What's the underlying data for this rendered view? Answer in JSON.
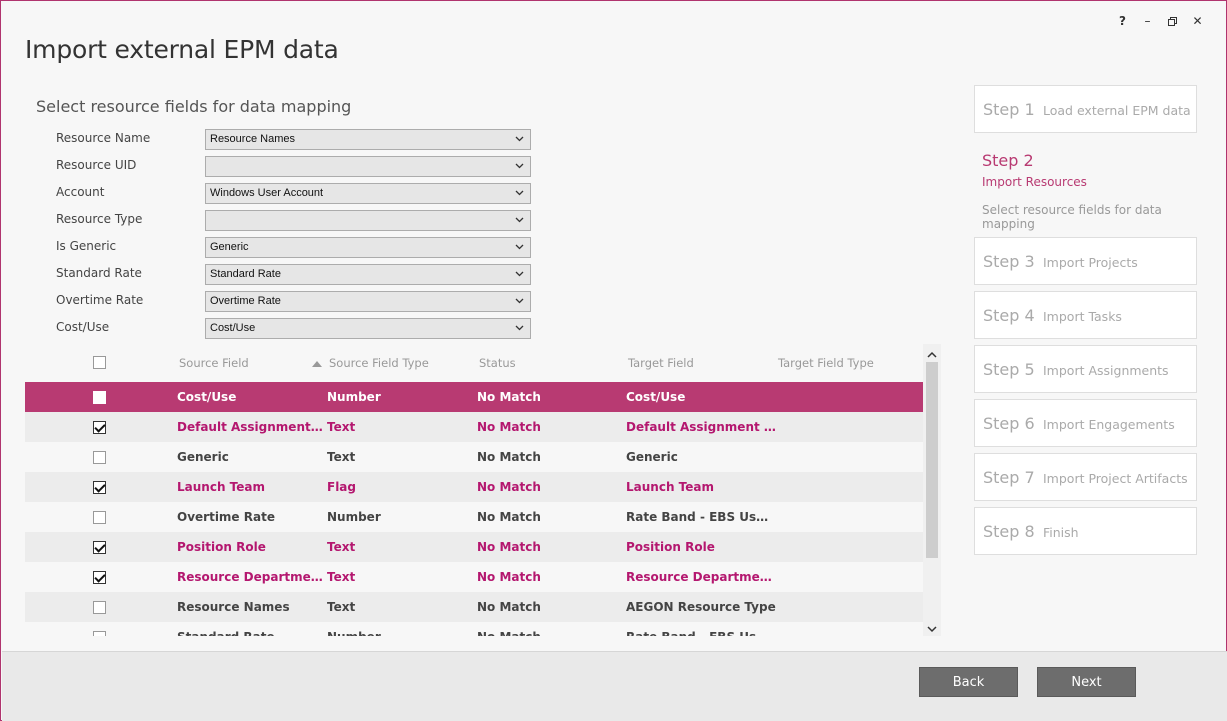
{
  "window": {
    "title": "Import external EPM data",
    "controls": {
      "help": "?",
      "minimize": "–",
      "restore": "🗗",
      "close": "✕"
    }
  },
  "section": {
    "title": "Select resource fields for data mapping"
  },
  "form": {
    "fields": [
      {
        "label": "Resource Name",
        "value": "Resource Names"
      },
      {
        "label": "Resource UID",
        "value": ""
      },
      {
        "label": "Account",
        "value": "Windows User Account"
      },
      {
        "label": "Resource Type",
        "value": ""
      },
      {
        "label": "Is Generic",
        "value": "Generic"
      },
      {
        "label": "Standard Rate",
        "value": "Standard Rate"
      },
      {
        "label": "Overtime Rate",
        "value": "Overtime Rate"
      },
      {
        "label": "Cost/Use",
        "value": "Cost/Use"
      }
    ]
  },
  "table": {
    "headers": {
      "source_field": "Source Field",
      "source_field_type": "Source Field Type",
      "status": "Status",
      "target_field": "Target Field",
      "target_field_type": "Target Field Type"
    },
    "rows": [
      {
        "checked": false,
        "source": "Cost/Use",
        "type": "Number",
        "status": "No Match",
        "target": "Cost/Use",
        "target_type": "",
        "state": "selected"
      },
      {
        "checked": true,
        "source": "Default Assignment Ow...",
        "type": "Text",
        "status": "No Match",
        "target": "Default Assignment Ow...",
        "target_type": "",
        "state": "mapped"
      },
      {
        "checked": false,
        "source": "Generic",
        "type": "Text",
        "status": "No Match",
        "target": "Generic",
        "target_type": "",
        "state": "unmapped"
      },
      {
        "checked": true,
        "source": "Launch Team",
        "type": "Flag",
        "status": "No Match",
        "target": "Launch Team",
        "target_type": "",
        "state": "mapped"
      },
      {
        "checked": false,
        "source": "Overtime Rate",
        "type": "Number",
        "status": "No Match",
        "target": "Rate Band - EBS Use Only",
        "target_type": "",
        "state": "unmapped"
      },
      {
        "checked": true,
        "source": "Position Role",
        "type": "Text",
        "status": "No Match",
        "target": "Position Role",
        "target_type": "",
        "state": "mapped"
      },
      {
        "checked": true,
        "source": "Resource Departments",
        "type": "Text",
        "status": "No Match",
        "target": "Resource Departments",
        "target_type": "",
        "state": "mapped"
      },
      {
        "checked": false,
        "source": "Resource Names",
        "type": "Text",
        "status": "No Match",
        "target": "AEGON Resource Type",
        "target_type": "",
        "state": "unmapped"
      },
      {
        "checked": false,
        "source": "Standard Rate",
        "type": "Number",
        "status": "No Match",
        "target": "Rate Band - EBS Use Only",
        "target_type": "",
        "state": "unmapped"
      }
    ]
  },
  "steps": {
    "step1": {
      "num": "Step 1",
      "name": "Load external EPM data"
    },
    "step2": {
      "num": "Step 2",
      "name": "Import Resources",
      "sub": "Select resource fields for data mapping"
    },
    "others": [
      {
        "num": "Step 3",
        "name": "Import Projects"
      },
      {
        "num": "Step 4",
        "name": "Import Tasks"
      },
      {
        "num": "Step 5",
        "name": "Import Assignments"
      },
      {
        "num": "Step 6",
        "name": "Import Engagements"
      },
      {
        "num": "Step 7",
        "name": "Import Project Artifacts"
      },
      {
        "num": "Step 8",
        "name": "Finish"
      }
    ]
  },
  "footer": {
    "back_label": "Back",
    "next_label": "Next"
  },
  "colors": {
    "accent": "#b83a72",
    "accent_text": "#b4176f",
    "button": "#6d6d6d"
  }
}
